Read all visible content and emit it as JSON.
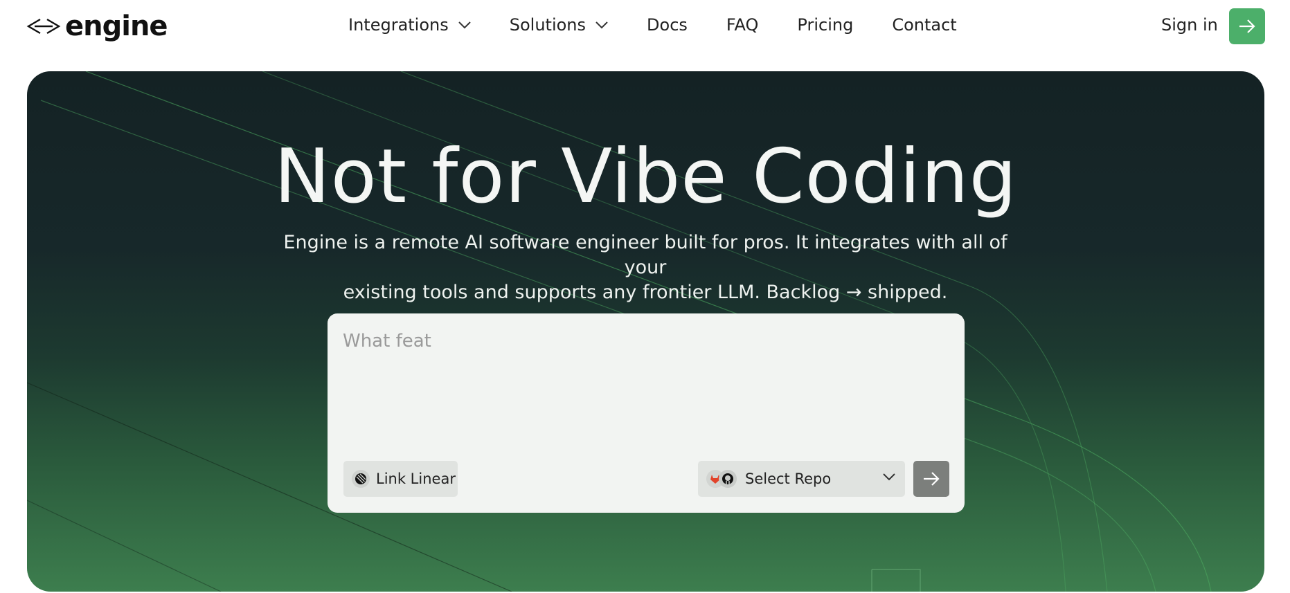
{
  "brand": {
    "logo_text": "engine",
    "logo_icon": "angle-brackets-logo-icon"
  },
  "nav": {
    "items": [
      {
        "label": "Integrations",
        "has_dropdown": true
      },
      {
        "label": "Solutions",
        "has_dropdown": true
      },
      {
        "label": "Docs",
        "has_dropdown": false
      },
      {
        "label": "FAQ",
        "has_dropdown": false
      },
      {
        "label": "Pricing",
        "has_dropdown": false
      },
      {
        "label": "Contact",
        "has_dropdown": false
      }
    ],
    "sign_in": "Sign in",
    "cta_icon": "arrow-right-icon",
    "cta_color": "#4caf6a"
  },
  "hero": {
    "title": "Not for Vibe Coding",
    "subtitle_line1": "Engine is a remote AI software engineer built for pros. It integrates with all of your",
    "subtitle_line2": "existing tools and supports any frontier LLM. Backlog → shipped."
  },
  "prompt": {
    "value": "What feat",
    "link_linear_label": "Link Linear",
    "link_linear_icon": "linear-icon",
    "select_repo_label": "Select Repo",
    "repo_icons": [
      "gitlab-icon",
      "github-icon"
    ],
    "submit_icon": "arrow-right-icon"
  }
}
